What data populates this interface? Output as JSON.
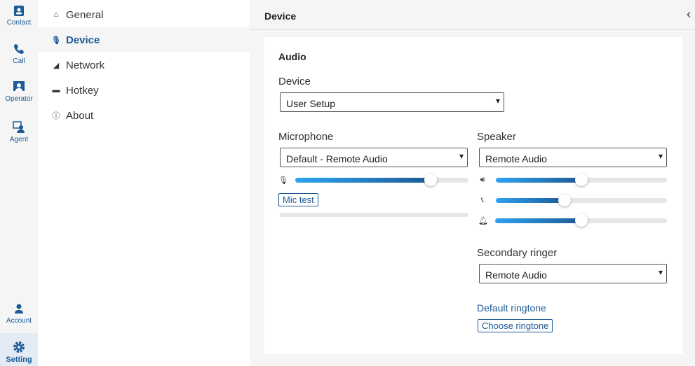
{
  "rail": {
    "items": [
      {
        "label": "Contact"
      },
      {
        "label": "Call"
      },
      {
        "label": "Operator"
      },
      {
        "label": "Agent"
      },
      {
        "label": "Account"
      },
      {
        "label": "Setting"
      }
    ]
  },
  "nav": {
    "items": [
      {
        "label": "General"
      },
      {
        "label": "Device"
      },
      {
        "label": "Network"
      },
      {
        "label": "Hotkey"
      },
      {
        "label": "About"
      }
    ]
  },
  "header": {
    "title": "Device"
  },
  "audio": {
    "title": "Audio",
    "device_label": "Device",
    "device_value": "User Setup",
    "mic_label": "Microphone",
    "mic_value": "Default - Remote Audio",
    "mic_level": 0.78,
    "mic_test": "Mic test",
    "mic_test_level": 0,
    "speaker_label": "Speaker",
    "speaker_value": "Remote Audio",
    "speaker_volume": 0.5,
    "call_volume": 0.4,
    "ring_volume": 0.5,
    "secondary_label": "Secondary ringer",
    "secondary_value": "Remote Audio",
    "default_ringtone": "Default ringtone",
    "choose_ringtone": "Choose ringtone"
  },
  "colors": {
    "accent": "#1d5a96",
    "gradient_start": "#2ea3f2"
  }
}
